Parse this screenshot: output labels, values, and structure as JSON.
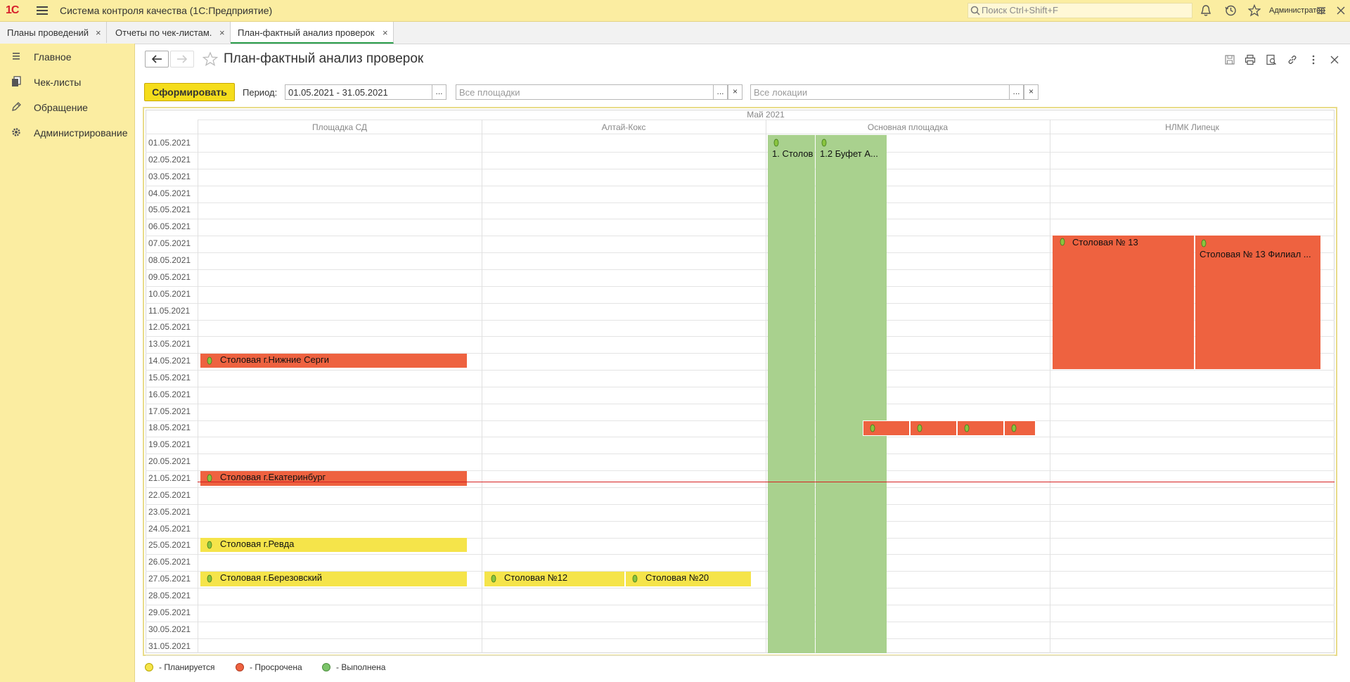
{
  "app": {
    "logo": "1С",
    "title": "Система контроля качества  (1С:Предприятие)",
    "search_placeholder": "Поиск Ctrl+Shift+F",
    "user": "Администратор"
  },
  "tabs": [
    {
      "label": "Планы проведений",
      "active": false
    },
    {
      "label": "Отчеты по чек-листам.",
      "active": false
    },
    {
      "label": "План-фактный анализ проверок",
      "active": true
    }
  ],
  "sidebar": {
    "items": [
      {
        "label": "Главное",
        "icon": "list-icon"
      },
      {
        "label": "Чек-листы",
        "icon": "documents-icon"
      },
      {
        "label": "Обращение",
        "icon": "pencil-icon"
      },
      {
        "label": "Администрирование",
        "icon": "gear-icon"
      }
    ]
  },
  "form": {
    "title": "План-фактный анализ проверок",
    "make_button": "Сформировать",
    "period_label": "Период:",
    "period_value": "01.05.2021 - 31.05.2021",
    "sites_placeholder": "Все площадки",
    "locations_placeholder": "Все локации",
    "select_btn": "...",
    "clear_btn": "×"
  },
  "grid": {
    "month": "Май 2021",
    "columns": [
      "Площадка СД",
      "Алтай-Кокс",
      "Основная площадка",
      "НЛМК Липецк"
    ],
    "dates": [
      "01.05.2021",
      "02.05.2021",
      "03.05.2021",
      "04.05.2021",
      "05.05.2021",
      "06.05.2021",
      "07.05.2021",
      "08.05.2021",
      "09.05.2021",
      "10.05.2021",
      "11.05.2021",
      "12.05.2021",
      "13.05.2021",
      "14.05.2021",
      "15.05.2021",
      "16.05.2021",
      "17.05.2021",
      "18.05.2021",
      "19.05.2021",
      "20.05.2021",
      "21.05.2021",
      "22.05.2021",
      "23.05.2021",
      "24.05.2021",
      "25.05.2021",
      "26.05.2021",
      "27.05.2021",
      "28.05.2021",
      "29.05.2021",
      "30.05.2021",
      "31.05.2021"
    ],
    "events": [
      {
        "label": "Столовая г.Нижние Серги",
        "status": "overdue"
      },
      {
        "label": "Столовая г.Екатеринбург",
        "status": "overdue"
      },
      {
        "label": "Столовая г.Ревда",
        "status": "planned"
      },
      {
        "label": "Столовая г.Березовский",
        "status": "planned"
      },
      {
        "label": "Столовая №12",
        "status": "planned"
      },
      {
        "label": "Столовая №20",
        "status": "planned"
      },
      {
        "label": "1. Столов",
        "status": "done"
      },
      {
        "label": "1.2 Буфет А...",
        "status": "done"
      },
      {
        "label": "Столовая № 13",
        "status": "overdue"
      },
      {
        "label": "Столовая № 13 Филиал ...",
        "status": "overdue"
      }
    ]
  },
  "legend": [
    {
      "label": "- Планируется",
      "color": "#f5e44a"
    },
    {
      "label": "- Просрочена",
      "color": "#ee6240"
    },
    {
      "label": "- Выполнена",
      "color": "#7cc46a"
    }
  ],
  "colors": {
    "accent": "#f5dd1c",
    "topbar": "#fbeda1",
    "overdue": "#ee6240",
    "planned": "#f5e44a",
    "done": "#a9d18e",
    "now_line": "#d62020"
  }
}
